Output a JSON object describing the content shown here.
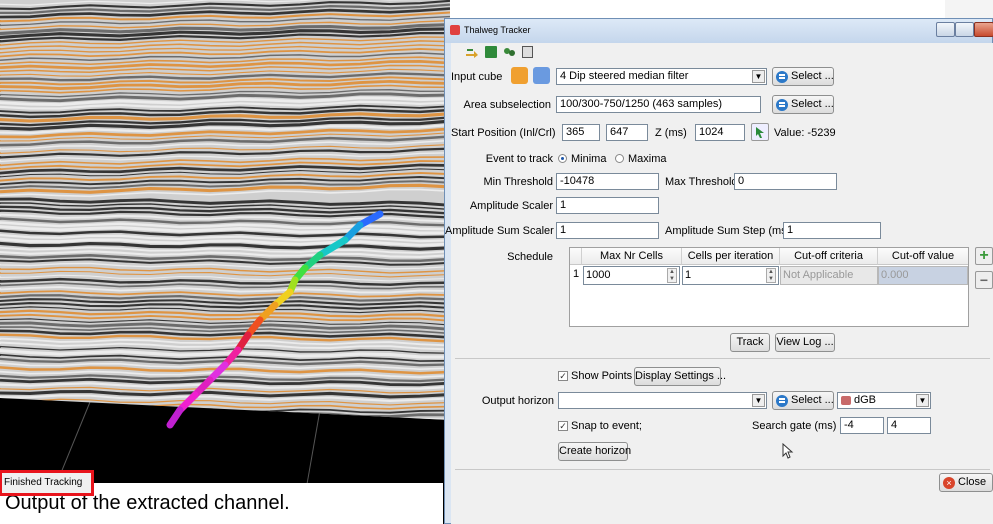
{
  "caption": "Output of the extracted channel.",
  "window": {
    "title": "Thalweg Tracker"
  },
  "toolbar": {
    "icons": [
      "open-arrow-icon",
      "save-icon",
      "tree-icon",
      "grid-settings-icon"
    ]
  },
  "input_cube": {
    "label": "Input cube",
    "value": "4 Dip steered median filter",
    "select_label": "Select ..."
  },
  "area": {
    "label": "Area subselection",
    "value": "100/300-750/1250 (463 samples)",
    "select_label": "Select ..."
  },
  "start": {
    "label": "Start Position (Inl/Crl)",
    "inl": "365",
    "crl": "647",
    "z_label": "Z (ms)",
    "z": "1024",
    "value_text": "Value: -5239"
  },
  "event": {
    "label": "Event to track",
    "minima": "Minima",
    "maxima": "Maxima",
    "selected": "Minima"
  },
  "threshold": {
    "min_label": "Min Threshold",
    "min": "-10478",
    "max_label": "Max Threshold",
    "max": "0"
  },
  "amp_scaler": {
    "label": "Amplitude Scaler",
    "value": "1"
  },
  "amp_sum": {
    "label": "Amplitude Sum Scaler",
    "value": "1",
    "step_label": "Amplitude Sum Step (ms)",
    "step": "1"
  },
  "schedule": {
    "label": "Schedule",
    "columns": [
      "Max Nr Cells",
      "Cells per iteration",
      "Cut-off criteria",
      "Cut-off value"
    ],
    "rows": [
      {
        "index": "1",
        "max_nr_cells": "1000",
        "cells_per_iteration": "1",
        "cutoff_criteria": "Not Applicable",
        "cutoff_value": "0.000"
      }
    ]
  },
  "track_button": "Track",
  "viewlog_button": "View Log ...",
  "show_points": {
    "label": "Show Points",
    "checked": true,
    "display_settings": "Display Settings ..."
  },
  "output": {
    "label": "Output horizon",
    "value": "",
    "select_label": "Select ...",
    "survey": "dGB"
  },
  "snap": {
    "label": "Snap to event;",
    "checked": true,
    "gate_label": "Search gate (ms)",
    "gate_from": "-4",
    "gate_to": "4"
  },
  "create_horizon": "Create horizon",
  "close_button": "Close",
  "status": "Finished Tracking",
  "colors": {
    "status_highlight": "#e8141c",
    "title_bar": "#c4d6ec",
    "close_red": "#d9452b"
  }
}
